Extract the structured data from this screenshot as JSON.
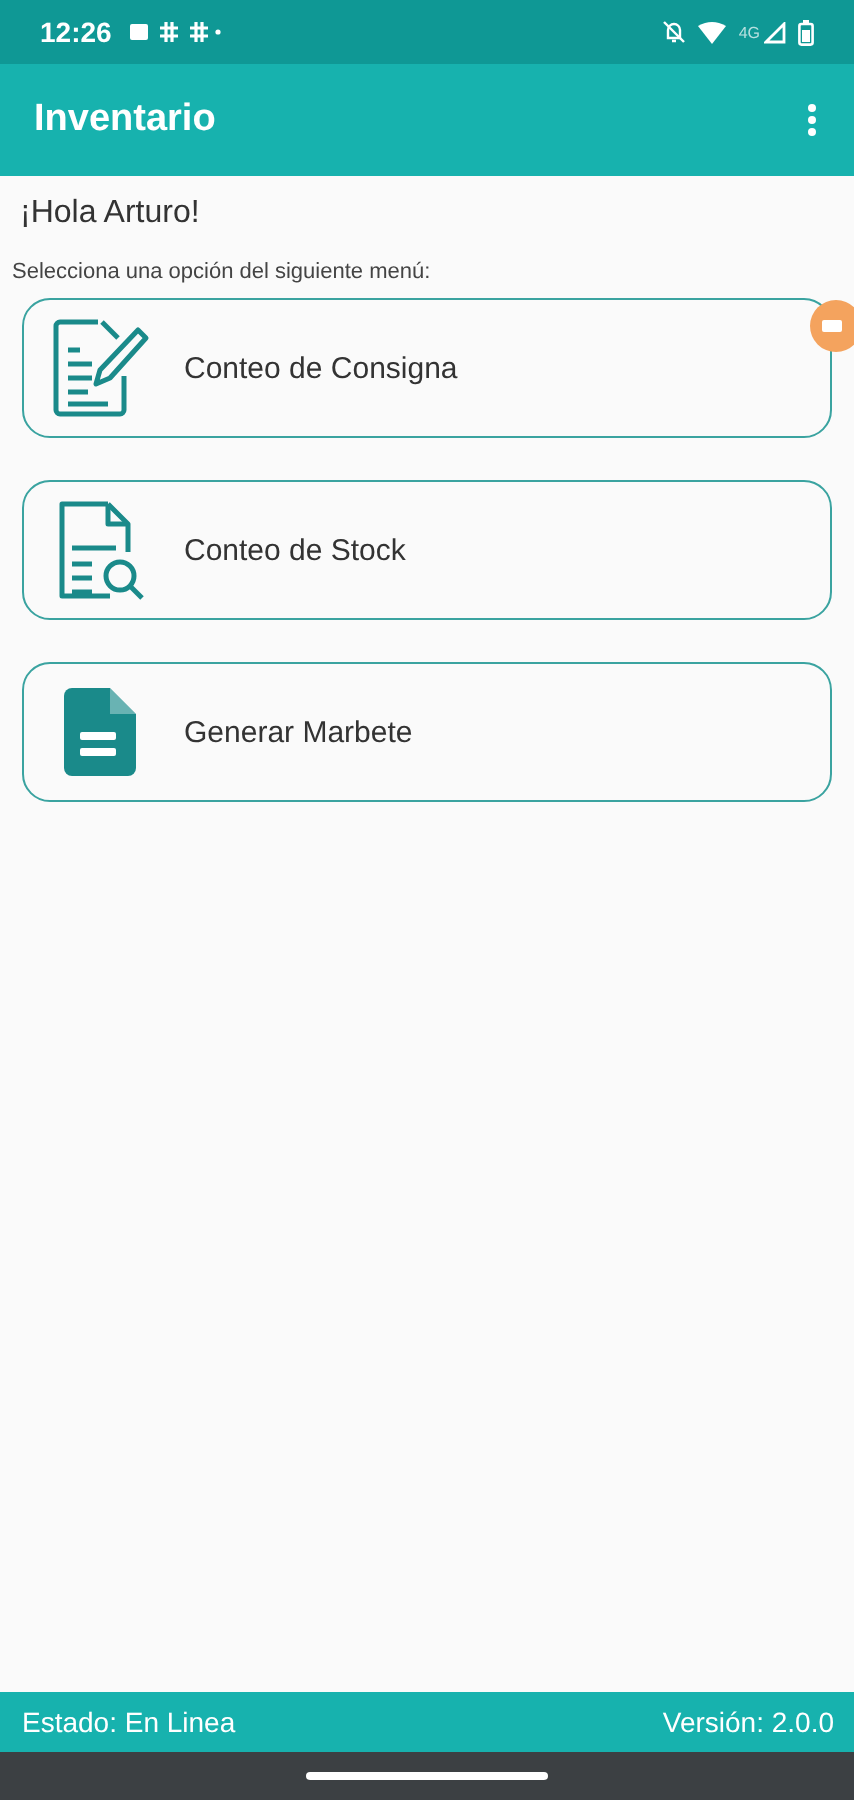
{
  "status_bar": {
    "time": "12:26",
    "network": "4G"
  },
  "app_bar": {
    "title": "Inventario"
  },
  "greeting": "¡Hola Arturo!",
  "prompt": "Selecciona una opción del siguiente menú:",
  "menu": [
    {
      "kind": "edit",
      "label": "Conteo de Consigna"
    },
    {
      "kind": "search",
      "label": "Conteo de Stock"
    },
    {
      "kind": "document",
      "label": "Generar Marbete"
    }
  ],
  "footer": {
    "status": "Estado: En Linea",
    "version": "Versión: 2.0.0"
  }
}
